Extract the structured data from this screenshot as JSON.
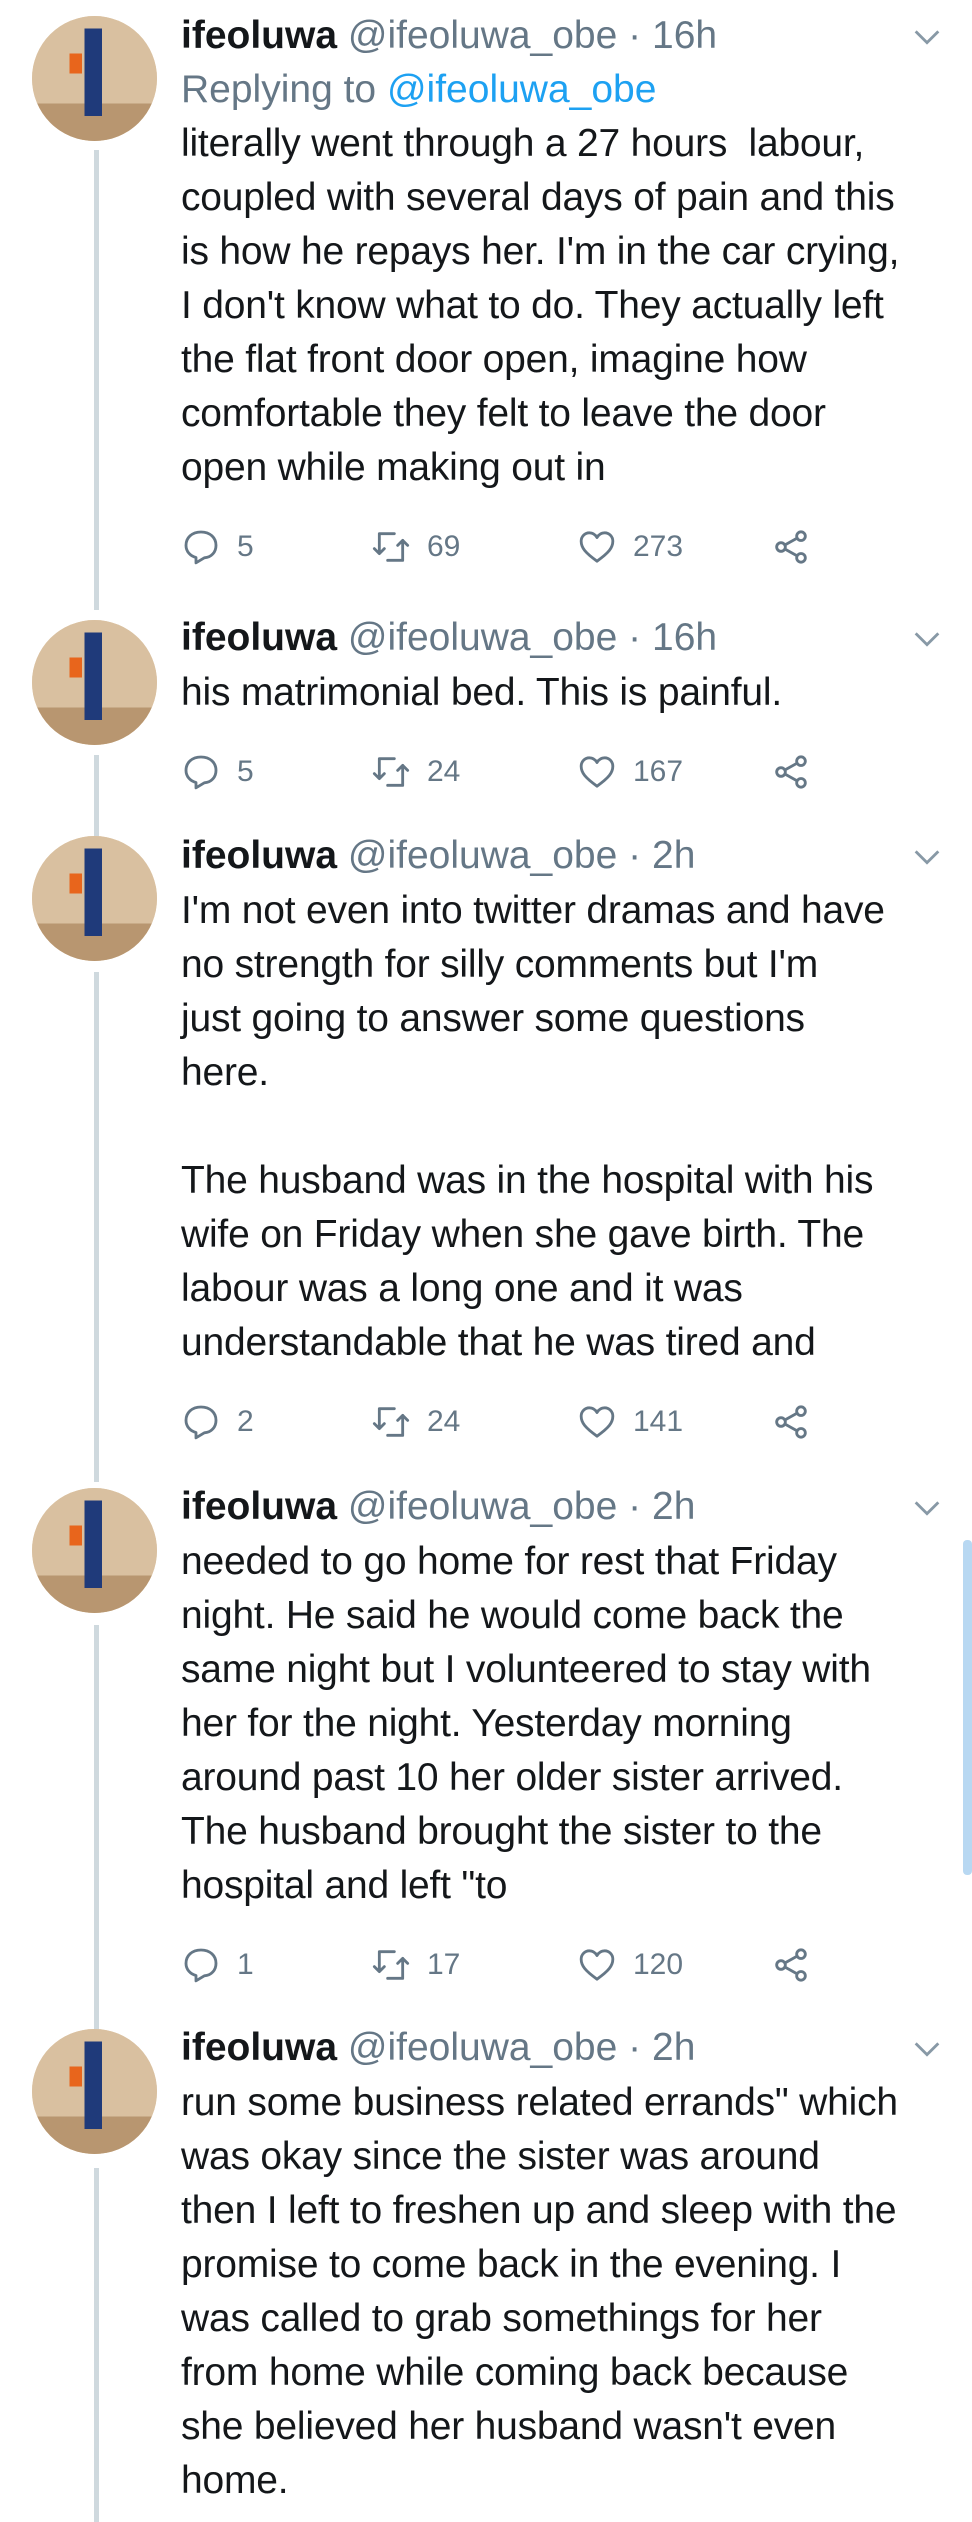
{
  "tweets": [
    {
      "name": "ifeoluwa",
      "handle": "@ifeoluwa_obe",
      "separator": "·",
      "time": "16h",
      "replying_prefix": "Replying to",
      "replying_handle": "@ifeoluwa_obe",
      "text": "literally went through a 27 hours  labour,\ncoupled with several days of pain and this\nis how he repays her. I'm in the car crying,\nI don't know what to do. They actually left\nthe flat front door open, imagine how\ncomfortable they felt to leave the door\nopen while making out in",
      "replies": "5",
      "retweets": "69",
      "likes": "273"
    },
    {
      "name": "ifeoluwa",
      "handle": "@ifeoluwa_obe",
      "separator": "·",
      "time": "16h",
      "text": "his matrimonial bed. This is painful.",
      "replies": "5",
      "retweets": "24",
      "likes": "167"
    },
    {
      "name": "ifeoluwa",
      "handle": "@ifeoluwa_obe",
      "separator": "·",
      "time": "2h",
      "text": "I'm not even into twitter dramas and have\nno strength for silly comments but I'm\njust going to answer some questions\nhere.\n\nThe husband was in the hospital with his\nwife on Friday when she gave birth. The\nlabour was a long one and it was\nunderstandable that he was tired and",
      "replies": "2",
      "retweets": "24",
      "likes": "141"
    },
    {
      "name": "ifeoluwa",
      "handle": "@ifeoluwa_obe",
      "separator": "·",
      "time": "2h",
      "text": "needed to go home for rest that Friday\nnight. He said he would come back the\nsame night but I volunteered to stay with\nher for the night. Yesterday morning\naround past 10 her older sister arrived.\nThe husband brought the sister to the\nhospital and left \"to",
      "replies": "1",
      "retweets": "17",
      "likes": "120"
    },
    {
      "name": "ifeoluwa",
      "handle": "@ifeoluwa_obe",
      "separator": "·",
      "time": "2h",
      "text": "run some business related errands\" which\nwas okay since the sister was around\nthen I left to freshen up and sleep with the\npromise to come back in the evening. I\nwas called to grab somethings for her\nfrom home while coming back because\nshe believed her husband wasn't even\nhome."
    }
  ],
  "icons": {
    "reply": "reply-icon",
    "retweet": "retweet-icon",
    "like": "heart-icon",
    "share": "share-icon",
    "more": "chevron-down-icon"
  },
  "colors": {
    "text": "#14171a",
    "secondary": "#657786",
    "link": "#1da1f2",
    "thread_line": "#cfd9de"
  }
}
